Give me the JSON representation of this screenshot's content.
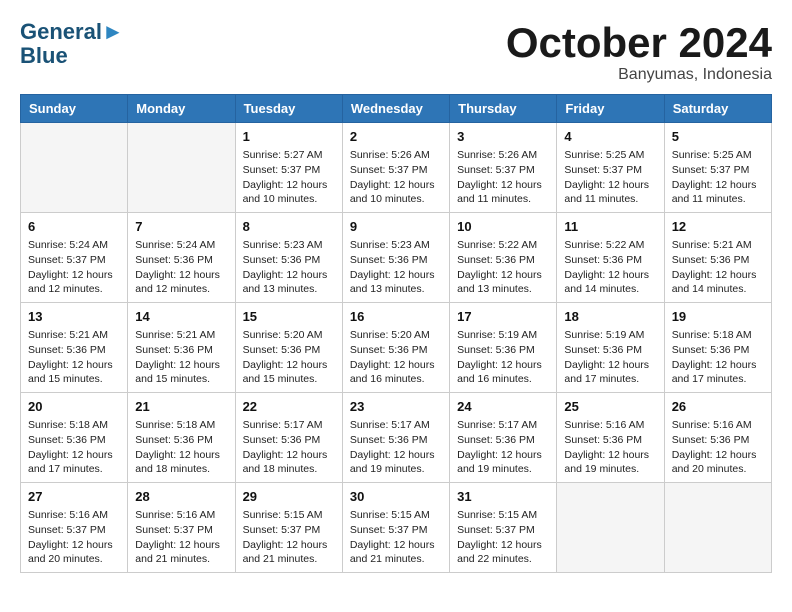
{
  "header": {
    "logo_line1": "General",
    "logo_line2": "Blue",
    "month": "October 2024",
    "location": "Banyumas, Indonesia"
  },
  "weekdays": [
    "Sunday",
    "Monday",
    "Tuesday",
    "Wednesday",
    "Thursday",
    "Friday",
    "Saturday"
  ],
  "weeks": [
    [
      {
        "day": "",
        "info": ""
      },
      {
        "day": "",
        "info": ""
      },
      {
        "day": "1",
        "info": "Sunrise: 5:27 AM\nSunset: 5:37 PM\nDaylight: 12 hours and 10 minutes."
      },
      {
        "day": "2",
        "info": "Sunrise: 5:26 AM\nSunset: 5:37 PM\nDaylight: 12 hours and 10 minutes."
      },
      {
        "day": "3",
        "info": "Sunrise: 5:26 AM\nSunset: 5:37 PM\nDaylight: 12 hours and 11 minutes."
      },
      {
        "day": "4",
        "info": "Sunrise: 5:25 AM\nSunset: 5:37 PM\nDaylight: 12 hours and 11 minutes."
      },
      {
        "day": "5",
        "info": "Sunrise: 5:25 AM\nSunset: 5:37 PM\nDaylight: 12 hours and 11 minutes."
      }
    ],
    [
      {
        "day": "6",
        "info": "Sunrise: 5:24 AM\nSunset: 5:37 PM\nDaylight: 12 hours and 12 minutes."
      },
      {
        "day": "7",
        "info": "Sunrise: 5:24 AM\nSunset: 5:36 PM\nDaylight: 12 hours and 12 minutes."
      },
      {
        "day": "8",
        "info": "Sunrise: 5:23 AM\nSunset: 5:36 PM\nDaylight: 12 hours and 13 minutes."
      },
      {
        "day": "9",
        "info": "Sunrise: 5:23 AM\nSunset: 5:36 PM\nDaylight: 12 hours and 13 minutes."
      },
      {
        "day": "10",
        "info": "Sunrise: 5:22 AM\nSunset: 5:36 PM\nDaylight: 12 hours and 13 minutes."
      },
      {
        "day": "11",
        "info": "Sunrise: 5:22 AM\nSunset: 5:36 PM\nDaylight: 12 hours and 14 minutes."
      },
      {
        "day": "12",
        "info": "Sunrise: 5:21 AM\nSunset: 5:36 PM\nDaylight: 12 hours and 14 minutes."
      }
    ],
    [
      {
        "day": "13",
        "info": "Sunrise: 5:21 AM\nSunset: 5:36 PM\nDaylight: 12 hours and 15 minutes."
      },
      {
        "day": "14",
        "info": "Sunrise: 5:21 AM\nSunset: 5:36 PM\nDaylight: 12 hours and 15 minutes."
      },
      {
        "day": "15",
        "info": "Sunrise: 5:20 AM\nSunset: 5:36 PM\nDaylight: 12 hours and 15 minutes."
      },
      {
        "day": "16",
        "info": "Sunrise: 5:20 AM\nSunset: 5:36 PM\nDaylight: 12 hours and 16 minutes."
      },
      {
        "day": "17",
        "info": "Sunrise: 5:19 AM\nSunset: 5:36 PM\nDaylight: 12 hours and 16 minutes."
      },
      {
        "day": "18",
        "info": "Sunrise: 5:19 AM\nSunset: 5:36 PM\nDaylight: 12 hours and 17 minutes."
      },
      {
        "day": "19",
        "info": "Sunrise: 5:18 AM\nSunset: 5:36 PM\nDaylight: 12 hours and 17 minutes."
      }
    ],
    [
      {
        "day": "20",
        "info": "Sunrise: 5:18 AM\nSunset: 5:36 PM\nDaylight: 12 hours and 17 minutes."
      },
      {
        "day": "21",
        "info": "Sunrise: 5:18 AM\nSunset: 5:36 PM\nDaylight: 12 hours and 18 minutes."
      },
      {
        "day": "22",
        "info": "Sunrise: 5:17 AM\nSunset: 5:36 PM\nDaylight: 12 hours and 18 minutes."
      },
      {
        "day": "23",
        "info": "Sunrise: 5:17 AM\nSunset: 5:36 PM\nDaylight: 12 hours and 19 minutes."
      },
      {
        "day": "24",
        "info": "Sunrise: 5:17 AM\nSunset: 5:36 PM\nDaylight: 12 hours and 19 minutes."
      },
      {
        "day": "25",
        "info": "Sunrise: 5:16 AM\nSunset: 5:36 PM\nDaylight: 12 hours and 19 minutes."
      },
      {
        "day": "26",
        "info": "Sunrise: 5:16 AM\nSunset: 5:36 PM\nDaylight: 12 hours and 20 minutes."
      }
    ],
    [
      {
        "day": "27",
        "info": "Sunrise: 5:16 AM\nSunset: 5:37 PM\nDaylight: 12 hours and 20 minutes."
      },
      {
        "day": "28",
        "info": "Sunrise: 5:16 AM\nSunset: 5:37 PM\nDaylight: 12 hours and 21 minutes."
      },
      {
        "day": "29",
        "info": "Sunrise: 5:15 AM\nSunset: 5:37 PM\nDaylight: 12 hours and 21 minutes."
      },
      {
        "day": "30",
        "info": "Sunrise: 5:15 AM\nSunset: 5:37 PM\nDaylight: 12 hours and 21 minutes."
      },
      {
        "day": "31",
        "info": "Sunrise: 5:15 AM\nSunset: 5:37 PM\nDaylight: 12 hours and 22 minutes."
      },
      {
        "day": "",
        "info": ""
      },
      {
        "day": "",
        "info": ""
      }
    ]
  ]
}
